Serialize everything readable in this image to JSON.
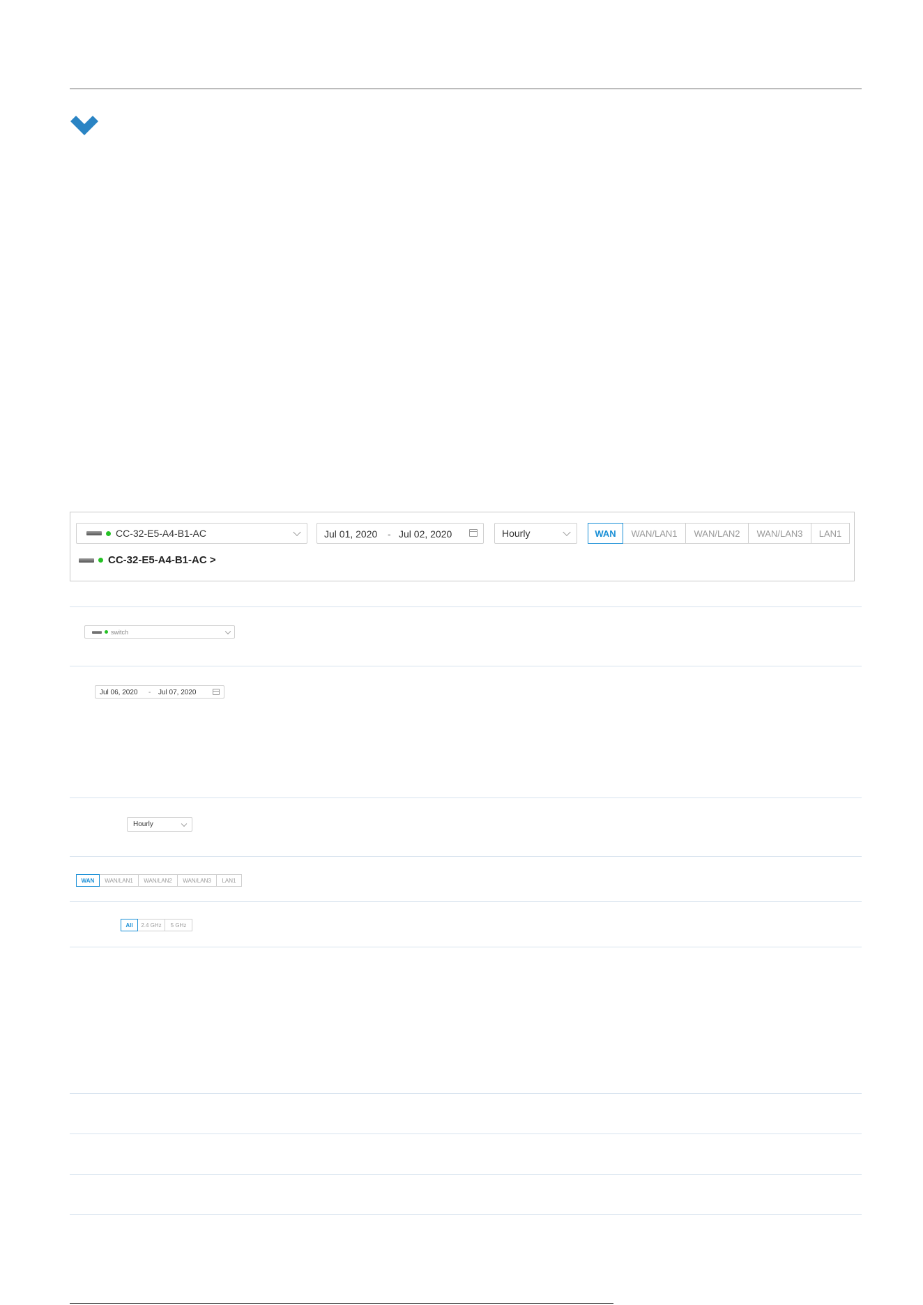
{
  "toolbar": {
    "device_select": "CC-32-E5-A4-B1-AC",
    "date_from": "Jul 01, 2020",
    "date_sep": "-",
    "date_to": "Jul 02, 2020",
    "interval": "Hourly",
    "ports": [
      "WAN",
      "WAN/LAN1",
      "WAN/LAN2",
      "WAN/LAN3",
      "LAN1"
    ],
    "active_port": "WAN",
    "device_link": "CC-32-E5-A4-B1-AC >"
  },
  "rows": {
    "switch_select": "switch",
    "date_range": {
      "from": "Jul 06, 2020",
      "sep": "-",
      "to": "Jul 07, 2020"
    },
    "interval": "Hourly",
    "ports": [
      "WAN",
      "WAN/LAN1",
      "WAN/LAN2",
      "WAN/LAN3",
      "LAN1"
    ],
    "bands": [
      "All",
      "2.4 GHz",
      "5 GHz"
    ]
  },
  "colors": {
    "accent": "#1a8fd6",
    "status_online": "#25c125",
    "chevron": "#2a84c4"
  },
  "icons": {
    "expand": "chevron-down-icon",
    "device": "device-icon",
    "calendar": "calendar-icon"
  }
}
